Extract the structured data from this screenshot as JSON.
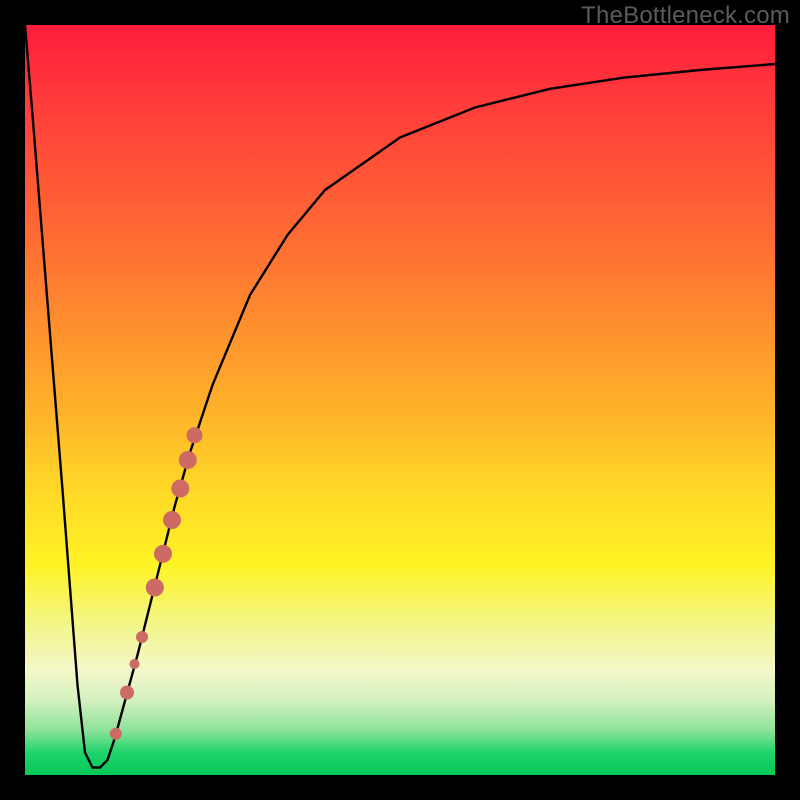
{
  "watermark": "TheBottleneck.com",
  "colors": {
    "curve": "#000000",
    "points": "#cd6a63",
    "gradient_top": "#ff1c3c",
    "gradient_bottom": "#06c957"
  },
  "chart_data": {
    "type": "line",
    "title": "",
    "xlabel": "",
    "ylabel": "",
    "xlim": [
      0,
      100
    ],
    "ylim": [
      0,
      100
    ],
    "grid": false,
    "series": [
      {
        "name": "bottleneck-curve",
        "x": [
          0,
          1,
          3,
          5,
          7,
          8,
          9,
          10,
          11,
          12,
          15,
          18,
          20,
          22,
          25,
          30,
          35,
          40,
          50,
          60,
          70,
          80,
          90,
          100
        ],
        "y": [
          100,
          88,
          63,
          38,
          12,
          3,
          1,
          1,
          2,
          5,
          16,
          28,
          36,
          43,
          52,
          64,
          72,
          78,
          85,
          89,
          91.5,
          93,
          94,
          94.8
        ]
      }
    ],
    "points": [
      {
        "x": 12.1,
        "y": 5.5,
        "r": 6
      },
      {
        "x": 13.6,
        "y": 11.0,
        "r": 7
      },
      {
        "x": 14.6,
        "y": 14.8,
        "r": 5
      },
      {
        "x": 15.6,
        "y": 18.4,
        "r": 6
      },
      {
        "x": 17.3,
        "y": 25.0,
        "r": 9
      },
      {
        "x": 18.4,
        "y": 29.5,
        "r": 9
      },
      {
        "x": 19.6,
        "y": 34.0,
        "r": 9
      },
      {
        "x": 20.7,
        "y": 38.2,
        "r": 9
      },
      {
        "x": 21.7,
        "y": 42.0,
        "r": 9
      },
      {
        "x": 22.6,
        "y": 45.3,
        "r": 8
      }
    ]
  }
}
